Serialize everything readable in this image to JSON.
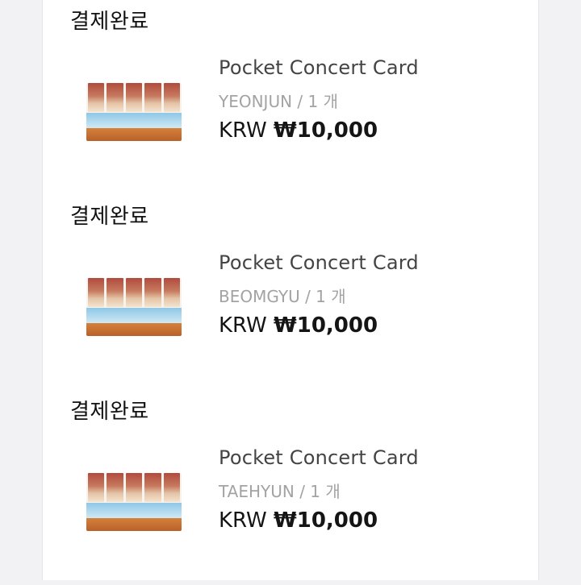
{
  "orders": [
    {
      "status": "결제완료",
      "product_name": "Pocket Concert Card",
      "option": "YEONJUN / 1 개",
      "currency": "KRW",
      "amount": "₩10,000"
    },
    {
      "status": "결제완료",
      "product_name": "Pocket Concert Card",
      "option": "BEOMGYU / 1 개",
      "currency": "KRW",
      "amount": "₩10,000"
    },
    {
      "status": "결제완료",
      "product_name": "Pocket Concert Card",
      "option": "TAEHYUN / 1 개",
      "currency": "KRW",
      "amount": "₩10,000"
    }
  ]
}
